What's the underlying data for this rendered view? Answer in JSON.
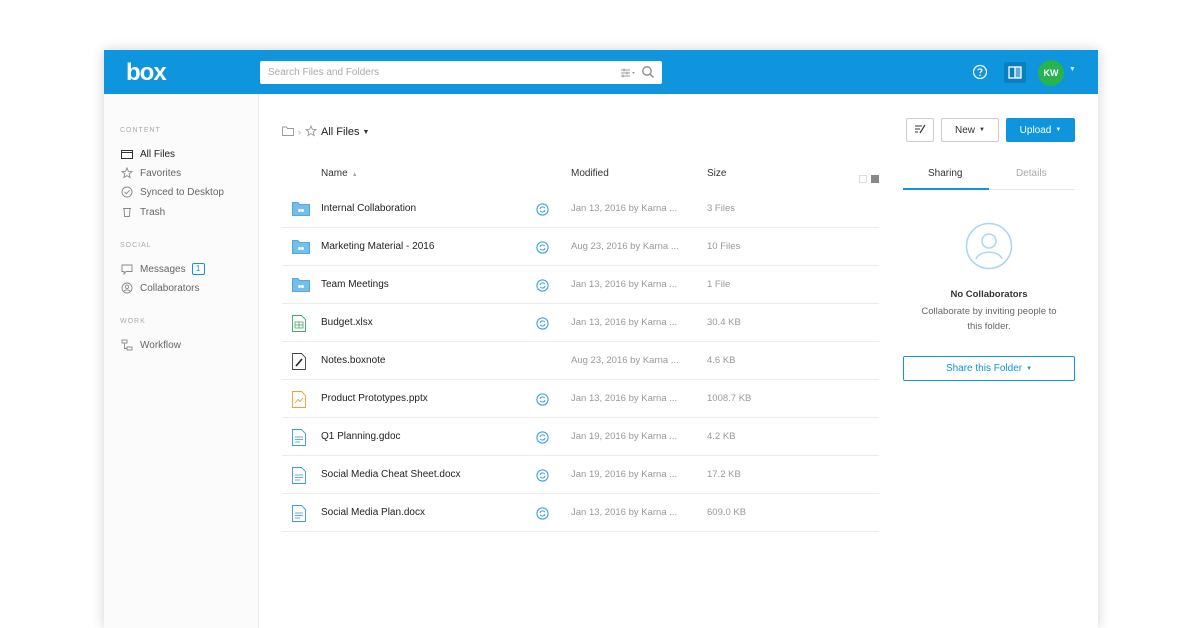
{
  "brand": {
    "logo": "box",
    "accent": "#0f95dd"
  },
  "topbar": {
    "search_placeholder": "Search Files and Folders",
    "user_initials": "KW"
  },
  "sidebar": {
    "sections": [
      {
        "heading": "CONTENT",
        "items": [
          {
            "label": "All Files",
            "icon": "folder-icon",
            "active": true
          },
          {
            "label": "Favorites",
            "icon": "star-icon"
          },
          {
            "label": "Synced to Desktop",
            "icon": "synced-icon"
          },
          {
            "label": "Trash",
            "icon": "trash-icon"
          }
        ]
      },
      {
        "heading": "SOCIAL",
        "items": [
          {
            "label": "Messages",
            "icon": "message-icon",
            "badge": "1"
          },
          {
            "label": "Collaborators",
            "icon": "collaborators-icon"
          }
        ]
      },
      {
        "heading": "WORK",
        "items": [
          {
            "label": "Workflow",
            "icon": "workflow-icon"
          }
        ]
      }
    ]
  },
  "breadcrumb": {
    "title": "All Files"
  },
  "toolbar": {
    "new_label": "New",
    "upload_label": "Upload"
  },
  "table": {
    "columns": {
      "name": "Name",
      "modified": "Modified",
      "size": "Size"
    },
    "rows": [
      {
        "name": "Internal Collaboration",
        "type": "folder",
        "synced": true,
        "modified": "Jan 13, 2016 by Karna ...",
        "size": "3 Files"
      },
      {
        "name": "Marketing Material - 2016",
        "type": "folder",
        "synced": true,
        "modified": "Aug 23, 2016 by Karna ...",
        "size": "10 Files"
      },
      {
        "name": "Team Meetings",
        "type": "folder",
        "synced": true,
        "modified": "Jan 13, 2016 by Karna ...",
        "size": "1 File"
      },
      {
        "name": "Budget.xlsx",
        "type": "spreadsheet",
        "synced": true,
        "modified": "Jan 13, 2016 by Karna ...",
        "size": "30.4 KB"
      },
      {
        "name": "Notes.boxnote",
        "type": "boxnote",
        "synced": false,
        "modified": "Aug 23, 2016 by Karna ...",
        "size": "4.6 KB"
      },
      {
        "name": "Product Prototypes.pptx",
        "type": "presentation",
        "synced": true,
        "modified": "Jan 13, 2016 by Karna ...",
        "size": "1008.7 KB"
      },
      {
        "name": "Q1 Planning.gdoc",
        "type": "document",
        "synced": true,
        "modified": "Jan 19, 2016 by Karna ...",
        "size": "4.2 KB"
      },
      {
        "name": "Social Media Cheat Sheet.docx",
        "type": "document",
        "synced": true,
        "modified": "Jan 19, 2016 by Karna ...",
        "size": "17.2 KB"
      },
      {
        "name": "Social Media Plan.docx",
        "type": "document",
        "synced": true,
        "modified": "Jan 13, 2016 by Karna ...",
        "size": "609.0 KB"
      }
    ]
  },
  "right_panel": {
    "tabs": [
      "Sharing",
      "Details"
    ],
    "active_tab": "Sharing",
    "empty_title": "No Collaborators",
    "empty_text": "Collaborate by inviting people to this folder.",
    "share_button": "Share this Folder"
  }
}
